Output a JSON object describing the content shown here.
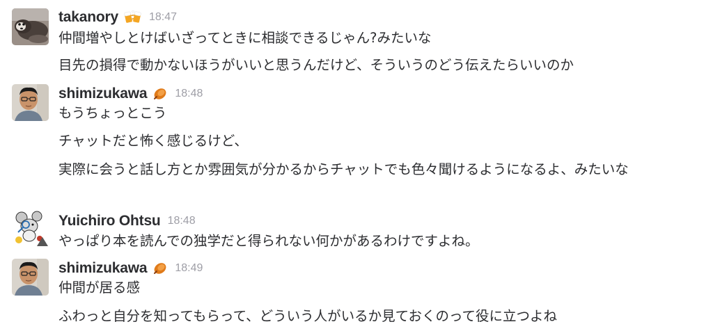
{
  "messages": [
    {
      "sender": "takanory",
      "badge_icon": "beer-mugs-icon",
      "time": "18:47",
      "lines": [
        "仲間増やしとけばいざってときに相談できるじゃん?みたいな",
        "目先の損得で動かないほうがいいと思うんだけど、そういうのどう伝えたらいいのか"
      ]
    },
    {
      "sender": "shimizukawa",
      "badge_icon": "sweet-potato-icon",
      "time": "18:48",
      "lines": [
        "もうちょっとこう",
        "チャットだと怖く感じるけど、",
        "実際に会うと話し方とか雰囲気が分かるからチャットでも色々聞けるようになるよ、みたいな"
      ]
    },
    {
      "sender": "Yuichiro Ohtsu",
      "time": "18:48",
      "lines": [
        "やっぱり本を読んでの独学だと得られない何かがあるわけですよね。"
      ]
    },
    {
      "sender": "shimizukawa",
      "badge_icon": "sweet-potato-icon",
      "time": "18:49",
      "lines": [
        "仲間が居る感",
        "ふわっと自分を知ってもらって、どういう人がいるか見ておくのって役に立つよね"
      ]
    }
  ]
}
